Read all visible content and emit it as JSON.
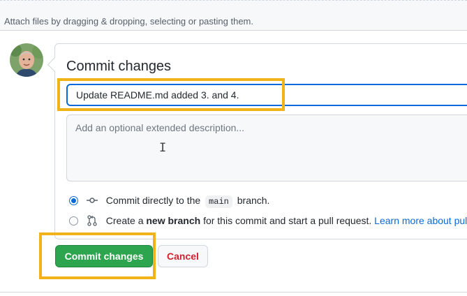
{
  "attach": {
    "text": "Attach files by dragging & dropping, selecting or pasting them."
  },
  "avatar": {
    "alt": "user avatar"
  },
  "commit": {
    "title": "Commit changes",
    "summary_value": "Update README.md added 3. and 4.",
    "description_placeholder": "Add an optional extended description...",
    "option_direct": {
      "prefix": "Commit directly to the",
      "branch": "main",
      "suffix": "branch.",
      "selected": true
    },
    "option_new_branch": {
      "prefix": "Create a",
      "bold": "new branch",
      "middle": "for this commit and start a pull request.",
      "link": "Learn more about pull r",
      "selected": false
    }
  },
  "buttons": {
    "commit_label": "Commit changes",
    "cancel_label": "Cancel"
  },
  "colors": {
    "primary": "#2da44e",
    "link": "#0969da",
    "danger": "#cf222e",
    "highlight": "#f2b21a"
  }
}
